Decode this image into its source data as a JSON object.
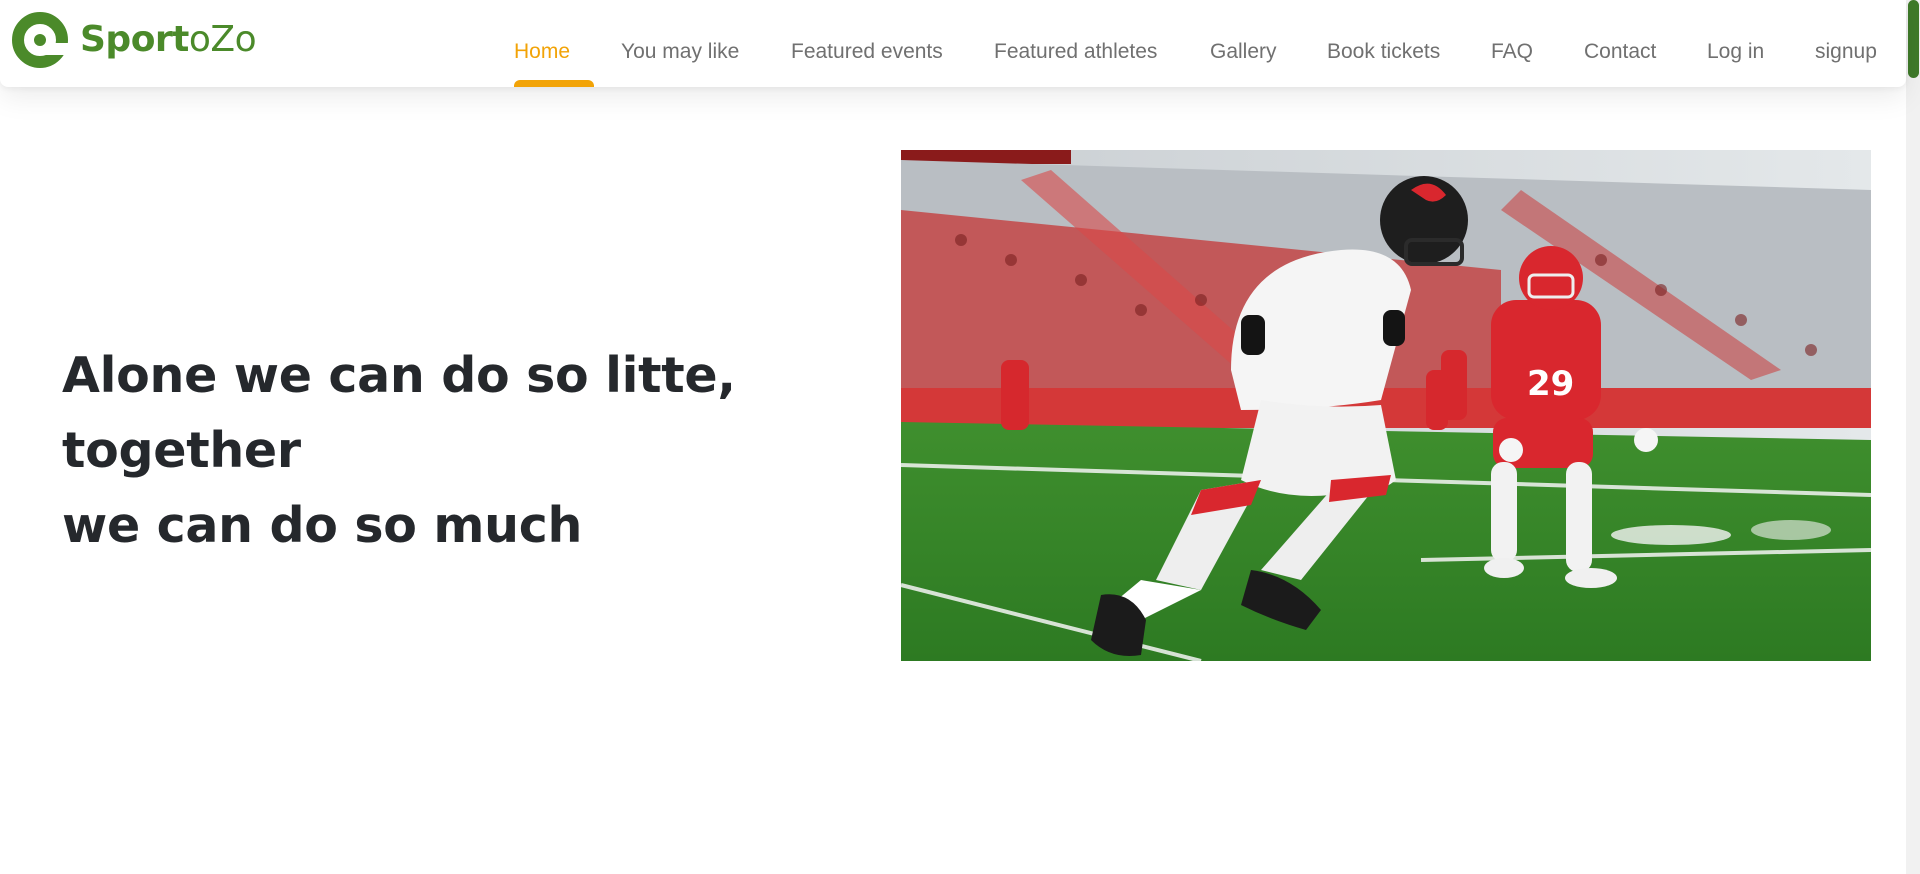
{
  "brand": {
    "name_bold": "Sport",
    "name_light": "oZo",
    "color": "#4b8a2a"
  },
  "nav": {
    "active_color": "#f2a307",
    "items": [
      {
        "label": "Home",
        "active": true
      },
      {
        "label": "You may like"
      },
      {
        "label": "Featured events"
      },
      {
        "label": "Featured athletes"
      },
      {
        "label": "Gallery"
      },
      {
        "label": "Book tickets"
      },
      {
        "label": "FAQ"
      },
      {
        "label": "Contact"
      },
      {
        "label": "Log in"
      },
      {
        "label": "signup"
      }
    ]
  },
  "hero": {
    "heading_line1": "Alone we can do so litte, together",
    "heading_line2": "we can do so much",
    "image_subject": "american-football-players-on-field",
    "jersey_number": "29"
  },
  "icons": {
    "logo": "circular-c-logo-icon"
  }
}
